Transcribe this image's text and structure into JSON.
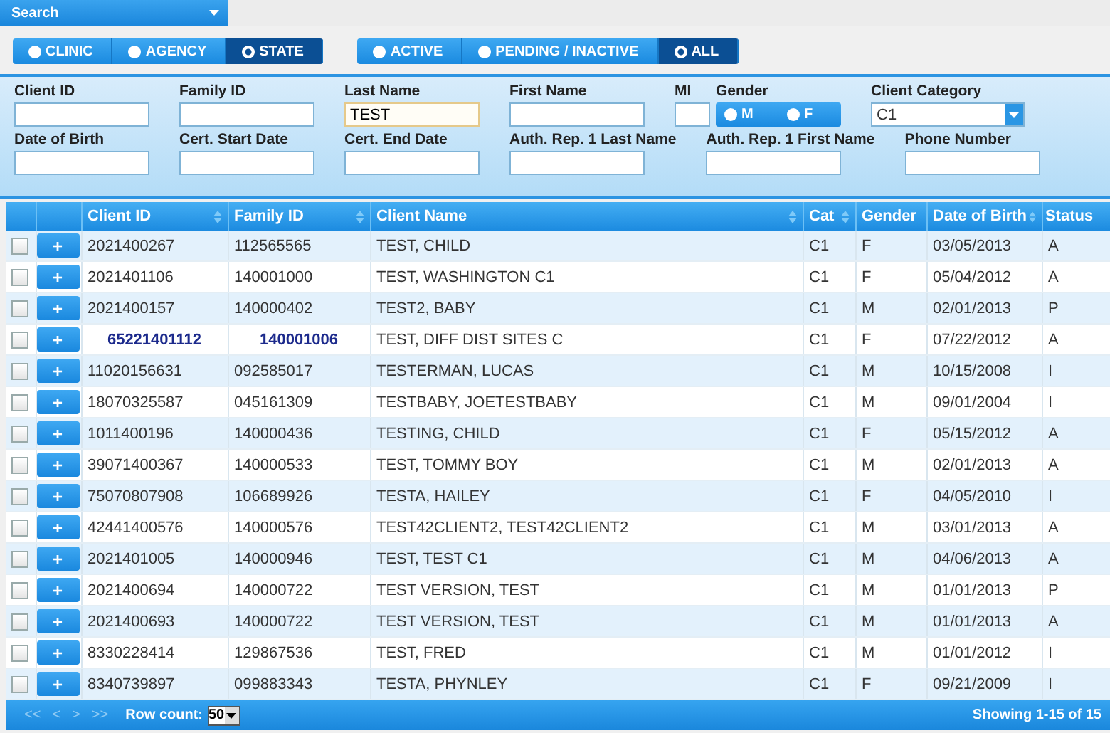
{
  "menu": {
    "label": "Search"
  },
  "scope_toggle": [
    {
      "label": "CLINIC",
      "selected": false
    },
    {
      "label": "AGENCY",
      "selected": false
    },
    {
      "label": "STATE",
      "selected": true
    }
  ],
  "status_toggle": [
    {
      "label": "ACTIVE",
      "selected": false
    },
    {
      "label": "PENDING / INACTIVE",
      "selected": false
    },
    {
      "label": "ALL",
      "selected": true
    }
  ],
  "filters": [
    [
      {
        "kind": "text",
        "label": "Client ID"
      },
      {
        "kind": "text",
        "label": "Family ID"
      },
      {
        "kind": "text",
        "label": "Last Name",
        "value": "TEST",
        "focused": true
      },
      {
        "kind": "text",
        "label": "First Name"
      },
      {
        "kind": "short",
        "label": "MI"
      },
      {
        "kind": "radio",
        "label": "Gender",
        "options": [
          {
            "label": "M",
            "selected": false
          },
          {
            "label": "F",
            "selected": false
          }
        ]
      },
      {
        "kind": "select",
        "label": "Client Category",
        "value": "C1"
      }
    ],
    [
      {
        "kind": "text",
        "label": "Date of Birth"
      },
      {
        "kind": "text",
        "label": "Cert. Start Date"
      },
      {
        "kind": "text",
        "label": "Cert. End Date"
      },
      {
        "kind": "text",
        "label": "Auth. Rep. 1 Last Name"
      },
      {
        "kind": "text",
        "label": "Auth. Rep. 1 First Name"
      },
      {
        "kind": "text",
        "label": "Phone Number"
      }
    ]
  ],
  "table": {
    "columns": [
      {
        "label": "Client ID",
        "sortable": true
      },
      {
        "label": "Family ID",
        "sortable": true
      },
      {
        "label": "Client Name",
        "sortable": true
      },
      {
        "label": "Cat",
        "sortable": true
      },
      {
        "label": "Gender",
        "sortable": false
      },
      {
        "label": "Date of Birth",
        "sortable": true
      },
      {
        "label": "Status",
        "sortable": false
      }
    ],
    "rows": [
      {
        "checked": false,
        "emphasized": false,
        "cells": [
          "2021400267",
          "112565565",
          "TEST, CHILD",
          "C1",
          "F",
          "03/05/2013",
          "A"
        ]
      },
      {
        "checked": false,
        "emphasized": false,
        "cells": [
          "2021401106",
          "140001000",
          "TEST, WASHINGTON C1",
          "C1",
          "F",
          "05/04/2012",
          "A"
        ]
      },
      {
        "checked": false,
        "emphasized": false,
        "cells": [
          "2021400157",
          "140000402",
          "TEST2, BABY",
          "C1",
          "M",
          "02/01/2013",
          "P"
        ]
      },
      {
        "checked": false,
        "emphasized": true,
        "cells": [
          "65221401112",
          "140001006",
          "TEST, DIFF DIST SITES C",
          "C1",
          "F",
          "07/22/2012",
          "A"
        ]
      },
      {
        "checked": false,
        "emphasized": false,
        "cells": [
          "11020156631",
          "092585017",
          "TESTERMAN, LUCAS",
          "C1",
          "M",
          "10/15/2008",
          "I"
        ]
      },
      {
        "checked": false,
        "emphasized": false,
        "cells": [
          "18070325587",
          "045161309",
          "TESTBABY, JOETESTBABY",
          "C1",
          "M",
          "09/01/2004",
          "I"
        ]
      },
      {
        "checked": false,
        "emphasized": false,
        "cells": [
          "1011400196",
          "140000436",
          "TESTING, CHILD",
          "C1",
          "F",
          "05/15/2012",
          "A"
        ]
      },
      {
        "checked": false,
        "emphasized": false,
        "cells": [
          "39071400367",
          "140000533",
          "TEST, TOMMY BOY",
          "C1",
          "M",
          "02/01/2013",
          "A"
        ]
      },
      {
        "checked": false,
        "emphasized": false,
        "cells": [
          "75070807908",
          "106689926",
          "TESTA, HAILEY",
          "C1",
          "F",
          "04/05/2010",
          "I"
        ]
      },
      {
        "checked": false,
        "emphasized": false,
        "cells": [
          "42441400576",
          "140000576",
          "TEST42CLIENT2, TEST42CLIENT2",
          "C1",
          "M",
          "03/01/2013",
          "A"
        ]
      },
      {
        "checked": false,
        "emphasized": false,
        "cells": [
          "2021401005",
          "140000946",
          "TEST, TEST C1",
          "C1",
          "M",
          "04/06/2013",
          "A"
        ]
      },
      {
        "checked": false,
        "emphasized": false,
        "cells": [
          "2021400694",
          "140000722",
          "TEST VERSION, TEST",
          "C1",
          "M",
          "01/01/2013",
          "P"
        ]
      },
      {
        "checked": false,
        "emphasized": false,
        "cells": [
          "2021400693",
          "140000722",
          "TEST VERSION, TEST",
          "C1",
          "M",
          "01/01/2013",
          "A"
        ]
      },
      {
        "checked": false,
        "emphasized": false,
        "cells": [
          "8330228414",
          "129867536",
          "TEST, FRED",
          "C1",
          "M",
          "01/01/2012",
          "I"
        ]
      },
      {
        "checked": false,
        "emphasized": false,
        "cells": [
          "8340739897",
          "099883343",
          "TESTA, PHYNLEY",
          "C1",
          "F",
          "09/21/2009",
          "I"
        ]
      }
    ],
    "add_button": "+"
  },
  "pager": {
    "buttons": [
      {
        "label": "<<",
        "disabled": true
      },
      {
        "label": "<",
        "disabled": true
      },
      {
        "label": ">",
        "disabled": true
      },
      {
        "label": ">>",
        "disabled": true
      }
    ],
    "row_count_label": "Row count:",
    "row_count": "50",
    "summary": "Showing 1-15 of 15"
  }
}
